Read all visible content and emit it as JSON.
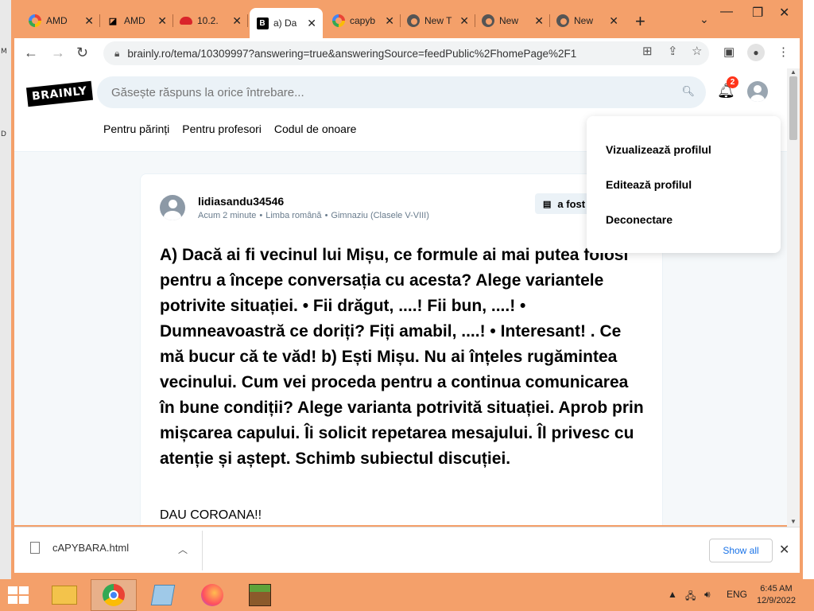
{
  "desktop": {
    "left_labels": [
      "M",
      "D"
    ]
  },
  "tabs": [
    {
      "title": "AMD",
      "icon": "google-icon"
    },
    {
      "title": "AMD",
      "icon": "amd-icon"
    },
    {
      "title": "10.2.",
      "icon": "redhat-icon"
    },
    {
      "title": "a) Da",
      "icon": "brainly-icon",
      "active": true
    },
    {
      "title": "capyb",
      "icon": "google-icon"
    },
    {
      "title": "New T",
      "icon": "chrome-icon"
    },
    {
      "title": "New",
      "icon": "chrome-icon"
    },
    {
      "title": "New",
      "icon": "chrome-icon"
    }
  ],
  "address_bar": {
    "url": "brainly.ro/tema/10309997?answering=true&answeringSource=feedPublic%2FhomePage%2F1"
  },
  "site": {
    "logo": "BRAINLY",
    "search_placeholder": "Găsește răspuns la orice întrebare...",
    "notification_count": "2",
    "subnav": [
      "Pentru părinți",
      "Pentru profesori",
      "Codul de onoare"
    ]
  },
  "question": {
    "author": "lidiasandu34546",
    "time": "Acum 2 minute",
    "subject": "Limba română",
    "level": "Gimnaziu (Clasele V-VIII)",
    "chip_label": "a fost",
    "text": "A) Dacă ai fi vecinul lui Mișu, ce formule ai mai putea folosi pentru a începe conversația cu acesta? Alege variantele potrivite situației. • Fii drăgut, ....! Fii bun, ....! • Dumneavoastră ce doriți? Fiți amabil, ....! • Interesant! . Ce mă bucur că te văd! b) Ești Mișu. Nu ai înțeles rugămintea vecinului. Cum vei proceda pentru a continua comunicarea în bune condiții? Alege varianta potrivită situației. Aprob prin mișcarea capului. Îi solicit repetarea mesajului. Îl privesc cu atenție și aștept. Schimb subiectul discuției.",
    "extra": "DAU COROANA!!"
  },
  "profile_menu": {
    "items": [
      "Vizualizează profilul",
      "Editează profilul",
      "Deconectare"
    ]
  },
  "downloads": {
    "file": "cAPYBARA.html",
    "show_all": "Show all"
  },
  "taskbar": {
    "language": "ENG",
    "time": "6:45 AM",
    "date": "12/9/2022"
  }
}
